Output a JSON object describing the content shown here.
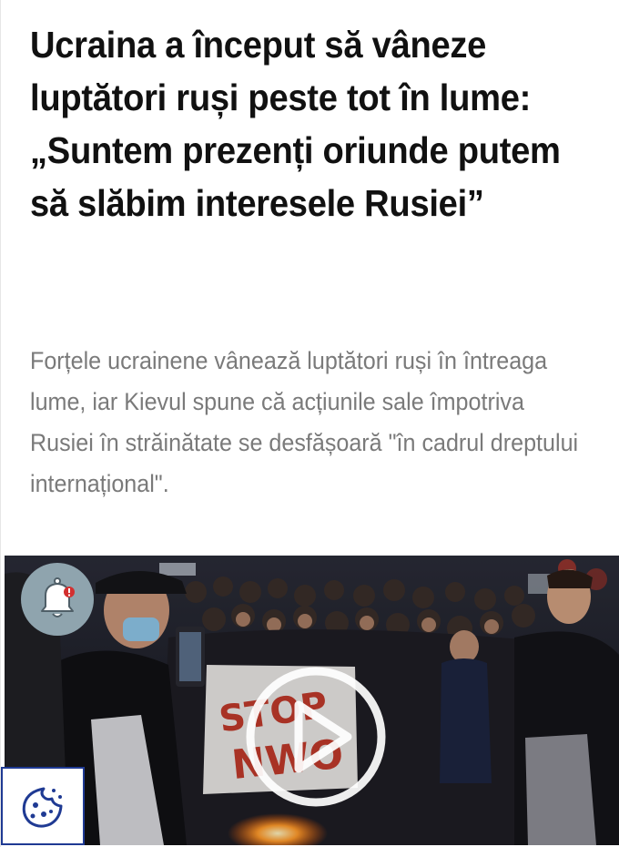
{
  "article": {
    "headline": "Ucraina a început să vâneze luptători ruși peste tot în lume: „Suntem prezenți oriunde putem să slăbim interesele Rusiei”",
    "lead": "Forțele ucrainene vânează luptători ruși în întreaga lume, iar Kievul spune că acțiunile sale împotriva Rusiei în străinătate se desfășoară \"în cadrul dreptului internațional\"."
  },
  "media": {
    "type": "video-thumbnail",
    "play_icon": "play-icon",
    "banner_text": "STOP NWO"
  },
  "widgets": {
    "notification_icon": "bell-icon",
    "cookie_icon": "cookie-icon"
  },
  "colors": {
    "headline": "#111111",
    "lead": "#7a7a7a",
    "notification_bg": "#8fa4ae",
    "notification_badge": "#d32f2f",
    "cookie_border": "#1f3a93",
    "cookie_icon": "#1f3a93"
  }
}
